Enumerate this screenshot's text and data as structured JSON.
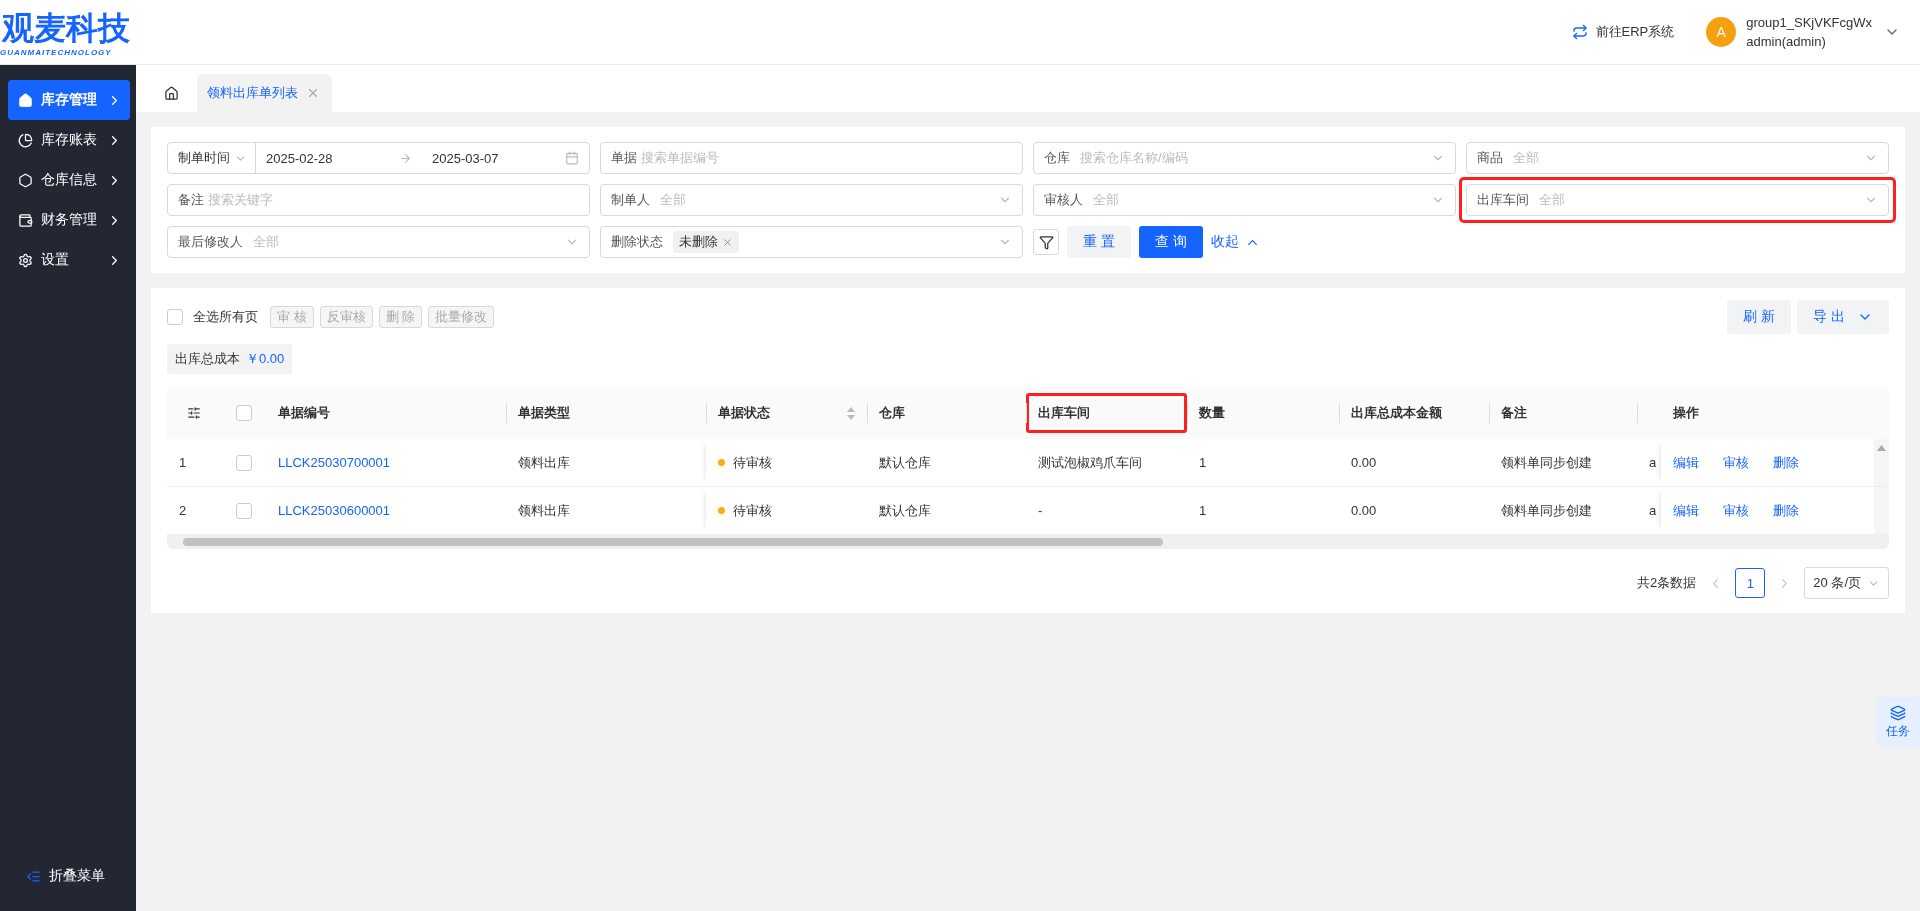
{
  "logo": {
    "title": "观麦科技",
    "subtitle": "GUANMAITECHNOLOGY"
  },
  "header": {
    "erp_link": "前往ERP系统",
    "avatar": "A",
    "group": "group1_SKjVKFcgWx",
    "user": "admin(admin)"
  },
  "sidebar": {
    "items": [
      {
        "label": "库存管理",
        "selected": true
      },
      {
        "label": "库存账表",
        "selected": false
      },
      {
        "label": "仓库信息",
        "selected": false
      },
      {
        "label": "财务管理",
        "selected": false
      },
      {
        "label": "设置",
        "selected": false
      }
    ],
    "collapse": "折叠菜单"
  },
  "tabs": [
    {
      "label": "领料出库单列表",
      "selected": true
    }
  ],
  "filters": [
    {
      "kind": "daterange",
      "label": "制单时间",
      "start": "2025-02-28",
      "end": "2025-03-07"
    },
    {
      "kind": "text",
      "label": "单据",
      "placeholder": "搜索单据编号"
    },
    {
      "kind": "select",
      "label": "仓库",
      "placeholder": "搜索仓库名称/编码"
    },
    {
      "kind": "select",
      "label": "商品",
      "placeholder": "全部"
    },
    {
      "kind": "text",
      "label": "备注",
      "placeholder": "搜索关键字"
    },
    {
      "kind": "select",
      "label": "制单人",
      "placeholder": "全部"
    },
    {
      "kind": "select",
      "label": "审核人",
      "placeholder": "全部"
    },
    {
      "kind": "select",
      "label": "出库车间",
      "placeholder": "全部",
      "highlighted": true
    },
    {
      "kind": "select",
      "label": "最后修改人",
      "placeholder": "全部"
    },
    {
      "kind": "tags",
      "label": "删除状态",
      "tags": [
        "未删除"
      ]
    }
  ],
  "filter_actions": {
    "reset": "重 置",
    "query": "查 询",
    "collapse": "收起"
  },
  "toolbar": {
    "select_all": {
      "label": "全选所有页",
      "checked": false
    },
    "batch": [
      {
        "label": "审 核",
        "disabled": true
      },
      {
        "label": "反审核",
        "disabled": true
      },
      {
        "label": "删 除",
        "disabled": true
      },
      {
        "label": "批量修改",
        "disabled": true
      }
    ],
    "refresh": "刷 新",
    "export": "导 出"
  },
  "summary": {
    "label": "出库总成本",
    "value": "￥0.00"
  },
  "table": {
    "header_checkbox": {
      "checked": false
    },
    "columns": [
      {
        "kind": "link",
        "label": "单据编号",
        "sortable": false,
        "highlighted": false
      },
      {
        "kind": "text",
        "label": "单据类型",
        "sortable": false,
        "highlighted": false
      },
      {
        "kind": "status",
        "label": "单据状态",
        "sortable": true,
        "highlighted": false
      },
      {
        "kind": "text",
        "label": "仓库",
        "sortable": false,
        "highlighted": false
      },
      {
        "kind": "text",
        "label": "出库车间",
        "sortable": false,
        "highlighted": true
      },
      {
        "kind": "text",
        "label": "数量",
        "sortable": false,
        "highlighted": false
      },
      {
        "kind": "text",
        "label": "出库总成本金额",
        "sortable": false,
        "highlighted": false
      },
      {
        "kind": "text",
        "label": "备注",
        "sortable": false,
        "highlighted": false
      },
      {
        "kind": "text",
        "sortable": false,
        "highlighted": false
      },
      {
        "kind": "actions",
        "label": "操作",
        "sortable": false,
        "highlighted": false
      }
    ],
    "rows": [
      {
        "index": "1",
        "checked": false,
        "cells": [
          "LLCK25030700001",
          "领料出库",
          {
            "text": "待审核",
            "color": "#faad14"
          },
          "默认仓库",
          "测试泡椒鸡爪车间",
          "1",
          "0.00",
          "领料单同步创建",
          "a",
          [
            "编辑",
            "审核",
            "删除"
          ]
        ]
      },
      {
        "index": "2",
        "checked": false,
        "cells": [
          "LLCK25030600001",
          "领料出库",
          {
            "text": "待审核",
            "color": "#faad14"
          },
          "默认仓库",
          "-",
          "1",
          "0.00",
          "领料单同步创建",
          "a",
          [
            "编辑",
            "审核",
            "删除"
          ]
        ]
      }
    ]
  },
  "pagination": {
    "total": "共2条数据",
    "pages": [
      {
        "label": "1",
        "selected": true
      }
    ],
    "page_size": "20 条/页"
  },
  "float_button": "任务"
}
